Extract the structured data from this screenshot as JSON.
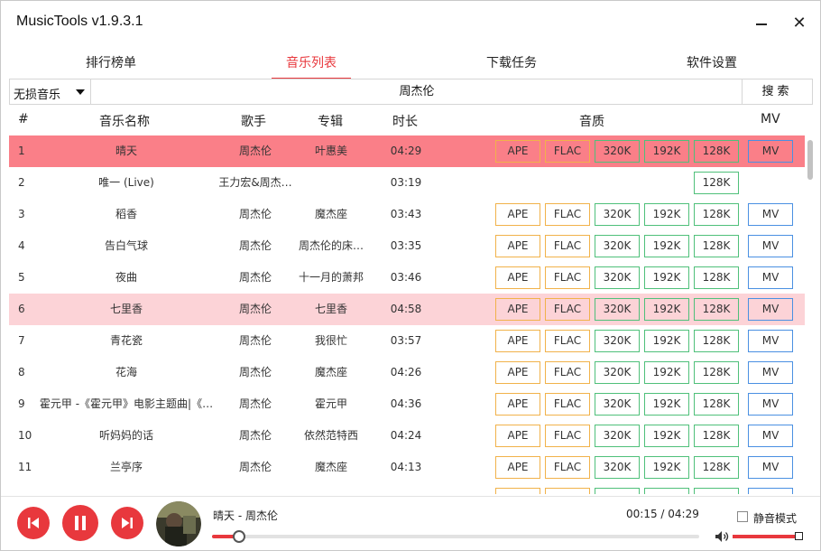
{
  "app": {
    "title": "MusicTools v1.9.3.1"
  },
  "window": {
    "minimize_icon": "minimize-icon",
    "close_icon": "close-icon",
    "close_glyph": "✕"
  },
  "tabs": [
    {
      "label": "排行榜单",
      "active": false
    },
    {
      "label": "音乐列表",
      "active": true
    },
    {
      "label": "下载任务",
      "active": false
    },
    {
      "label": "软件设置",
      "active": false
    }
  ],
  "search": {
    "source_selected": "无损音乐",
    "query": "周杰伦",
    "button": "搜索"
  },
  "table": {
    "headers": {
      "index": "#",
      "name": "音乐名称",
      "artist": "歌手",
      "album": "专辑",
      "duration": "时长",
      "quality": "音质",
      "mv": "MV"
    },
    "quality_labels": {
      "ape": "APE",
      "flac": "FLAC",
      "q320": "320K",
      "q192": "192K",
      "q128": "128K",
      "mv": "MV"
    },
    "rows": [
      {
        "index": "1",
        "name": "晴天",
        "artist": "周杰伦",
        "album": "叶惠美",
        "duration": "04:29",
        "state": "playing",
        "ape": true,
        "flac": true,
        "q320": true,
        "q192": true,
        "q128": true,
        "mv": true
      },
      {
        "index": "2",
        "name": "唯一 (Live)",
        "artist": "王力宏&周杰…",
        "album": "",
        "duration": "03:19",
        "state": "",
        "ape": false,
        "flac": false,
        "q320": false,
        "q192": false,
        "q128": true,
        "mv": false
      },
      {
        "index": "3",
        "name": "稻香",
        "artist": "周杰伦",
        "album": "魔杰座",
        "duration": "03:43",
        "state": "",
        "ape": true,
        "flac": true,
        "q320": true,
        "q192": true,
        "q128": true,
        "mv": true
      },
      {
        "index": "4",
        "name": "告白气球",
        "artist": "周杰伦",
        "album": "周杰伦的床…",
        "duration": "03:35",
        "state": "",
        "ape": true,
        "flac": true,
        "q320": true,
        "q192": true,
        "q128": true,
        "mv": true
      },
      {
        "index": "5",
        "name": "夜曲",
        "artist": "周杰伦",
        "album": "十一月的萧邦",
        "duration": "03:46",
        "state": "",
        "ape": true,
        "flac": true,
        "q320": true,
        "q192": true,
        "q128": true,
        "mv": true
      },
      {
        "index": "6",
        "name": "七里香",
        "artist": "周杰伦",
        "album": "七里香",
        "duration": "04:58",
        "state": "selected",
        "ape": true,
        "flac": true,
        "q320": true,
        "q192": true,
        "q128": true,
        "mv": true
      },
      {
        "index": "7",
        "name": "青花瓷",
        "artist": "周杰伦",
        "album": "我很忙",
        "duration": "03:57",
        "state": "",
        "ape": true,
        "flac": true,
        "q320": true,
        "q192": true,
        "q128": true,
        "mv": true
      },
      {
        "index": "8",
        "name": "花海",
        "artist": "周杰伦",
        "album": "魔杰座",
        "duration": "04:26",
        "state": "",
        "ape": true,
        "flac": true,
        "q320": true,
        "q192": true,
        "q128": true,
        "mv": true
      },
      {
        "index": "9",
        "name": "霍元甲 -《霍元甲》电影主题曲|《…",
        "artist": "周杰伦",
        "album": "霍元甲",
        "duration": "04:36",
        "state": "",
        "ape": true,
        "flac": true,
        "q320": true,
        "q192": true,
        "q128": true,
        "mv": true
      },
      {
        "index": "10",
        "name": "听妈妈的话",
        "artist": "周杰伦",
        "album": "依然范特西",
        "duration": "04:24",
        "state": "",
        "ape": true,
        "flac": true,
        "q320": true,
        "q192": true,
        "q128": true,
        "mv": true
      },
      {
        "index": "11",
        "name": "兰亭序",
        "artist": "周杰伦",
        "album": "魔杰座",
        "duration": "04:13",
        "state": "",
        "ape": true,
        "flac": true,
        "q320": true,
        "q192": true,
        "q128": true,
        "mv": true
      },
      {
        "index": "",
        "name": "",
        "artist": "",
        "album": "",
        "duration": "",
        "state": "partial",
        "ape": true,
        "flac": true,
        "q320": true,
        "q192": true,
        "q128": true,
        "mv": true
      }
    ]
  },
  "player": {
    "now_playing": "晴天 - 周杰伦",
    "time": "00:15 / 04:29",
    "progress": 0.056,
    "mute_label": "静音模式",
    "mute_checked": false,
    "volume": 1.0,
    "icons": {
      "prev": "skip-previous-icon",
      "pause": "pause-icon",
      "next": "skip-next-icon",
      "volume": "volume-icon"
    }
  },
  "colors": {
    "accent": "#e8383d",
    "playing_row": "#fa7f88",
    "selected_row": "#fcd3d7",
    "lossless_border": "#f1b24a",
    "mp3_border": "#4fc07a",
    "mv_border": "#4a90e2"
  }
}
